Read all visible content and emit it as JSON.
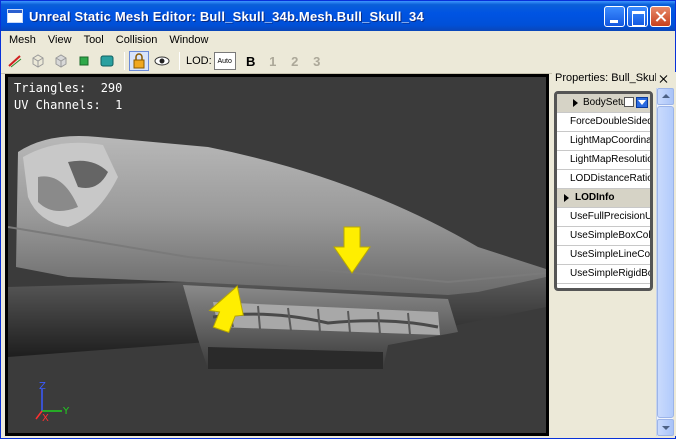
{
  "window": {
    "title": "Unreal Static Mesh Editor: Bull_Skull_34b.Mesh.Bull_Skull_34"
  },
  "menu": [
    "Mesh",
    "View",
    "Tool",
    "Collision",
    "Window"
  ],
  "toolbar": {
    "icons": [
      "normals-icon",
      "wireframe-box-icon",
      "solid-box-icon",
      "collision-green-icon",
      "collision-teal-icon",
      "lock-icon",
      "eye-icon"
    ],
    "lod_label": "LOD:",
    "lod_auto": "Auto",
    "lod_buttons": [
      "B",
      "1",
      "2",
      "3"
    ]
  },
  "viewport": {
    "stats": {
      "triangles_label": "Triangles:",
      "triangles_value": "290",
      "uv_label": "UV Channels:",
      "uv_value": "1"
    },
    "axis": {
      "z": "Z",
      "y": "Y",
      "x": "X"
    },
    "annotation_color": "#ffee00"
  },
  "properties": {
    "title": "Properties: Bull_Skull_",
    "rows": [
      {
        "label": "BodySetup",
        "type": "category-first"
      },
      {
        "label": "ForceDoubleSidedShadowVolumes",
        "type": "prop"
      },
      {
        "label": "LightMapCoordinateIndex",
        "type": "prop"
      },
      {
        "label": "LightMapResolution",
        "type": "prop"
      },
      {
        "label": "LODDistanceRatio",
        "type": "prop"
      },
      {
        "label": "LODInfo",
        "type": "category"
      },
      {
        "label": "UseFullPrecisionUVs",
        "type": "prop"
      },
      {
        "label": "UseSimpleBoxCollision",
        "type": "prop"
      },
      {
        "label": "UseSimpleLineCollision",
        "type": "prop"
      },
      {
        "label": "UseSimpleRigidBodyCollision",
        "type": "prop"
      }
    ]
  }
}
